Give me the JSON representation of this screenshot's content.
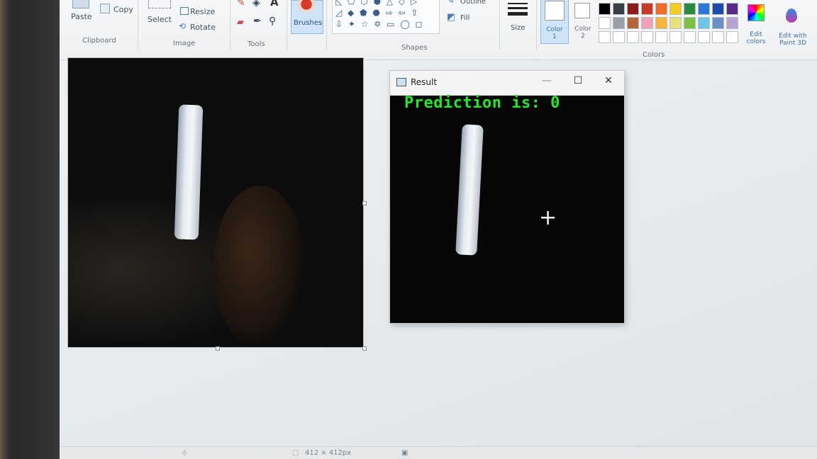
{
  "ribbon": {
    "clipboard": {
      "paste": "Paste",
      "copy": "Copy",
      "label": "Clipboard"
    },
    "image": {
      "select": "Select",
      "resize": "Resize",
      "rotate": "Rotate",
      "label": "Image"
    },
    "tools": {
      "label": "Tools"
    },
    "brushes": {
      "label": "Brushes"
    },
    "shapes": {
      "outline": "Outline",
      "fill": "Fill",
      "label": "Shapes"
    },
    "size": {
      "label": "Size"
    },
    "colors": {
      "color1": "Color\n1",
      "color2": "Color\n2",
      "edit_colors": "Edit\ncolors",
      "edit_paint3d": "Edit with\nPaint 3D",
      "label": "Colors",
      "palette_row1": [
        "#000000",
        "#3a3f47",
        "#8b1b1b",
        "#c83a2a",
        "#ee6b2a",
        "#f2cc1e",
        "#2b8a3e",
        "#2b78d6",
        "#1e4aa8",
        "#5b2a86"
      ],
      "palette_row2": [
        "#ffffff",
        "#9aa0a6",
        "#b5673a",
        "#f0a0b8",
        "#f5b63a",
        "#e8e07a",
        "#7bc043",
        "#6fc5e6",
        "#6a8ec8",
        "#b9a3d6"
      ]
    }
  },
  "result_window": {
    "title": "Result",
    "prediction": "Prediction is: 0",
    "minimize": "—",
    "maximize": "☐",
    "close": "✕"
  },
  "statusbar": {
    "size_text": "412 × 412px"
  }
}
